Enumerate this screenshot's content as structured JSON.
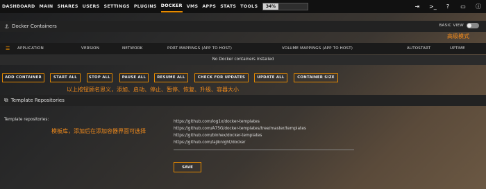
{
  "nav": {
    "items": [
      "DASHBOARD",
      "MAIN",
      "SHARES",
      "USERS",
      "SETTINGS",
      "PLUGINS",
      "DOCKER",
      "VMS",
      "APPS",
      "STATS",
      "TOOLS"
    ],
    "active": "DOCKER",
    "usage_text": "34%",
    "usage_fraction": 0.34,
    "icons": [
      "logout-icon",
      "terminal-icon",
      "help-icon",
      "monitor-icon",
      "info-icon"
    ]
  },
  "docker_section": {
    "title": "Docker Containers",
    "toggle_label": "BASIC VIEW",
    "annotation": "高级模式"
  },
  "table": {
    "columns": [
      "APPLICATION",
      "VERSION",
      "NETWORK",
      "PORT MAPPINGS (APP TO HOST)",
      "VOLUME MAPPINGS (APP TO HOST)",
      "AUTOSTART",
      "UPTIME"
    ],
    "empty_message": "No Docker containers installed"
  },
  "buttons": [
    "ADD CONTAINER",
    "START ALL",
    "STOP ALL",
    "PAUSE ALL",
    "RESUME ALL",
    "CHECK FOR UPDATES",
    "UPDATE ALL",
    "CONTAINER SIZE"
  ],
  "buttons_annotation": "以上按钮顾名思义，添加、启动、停止、暂停、恢复、升级、容器大小",
  "template_section": {
    "title": "Template Repositories",
    "label": "Template repositories:",
    "annotation": "模板库，添加后在添加容器界面可选择",
    "repos": [
      "https://github.com/log1x/docker-templates",
      "https://github.com/A75G/docker-templates/tree/master/templates",
      "https://github.com/binhex/docker-templates",
      "https://github.com/lajiknight/docker"
    ],
    "save_label": "SAVE"
  }
}
